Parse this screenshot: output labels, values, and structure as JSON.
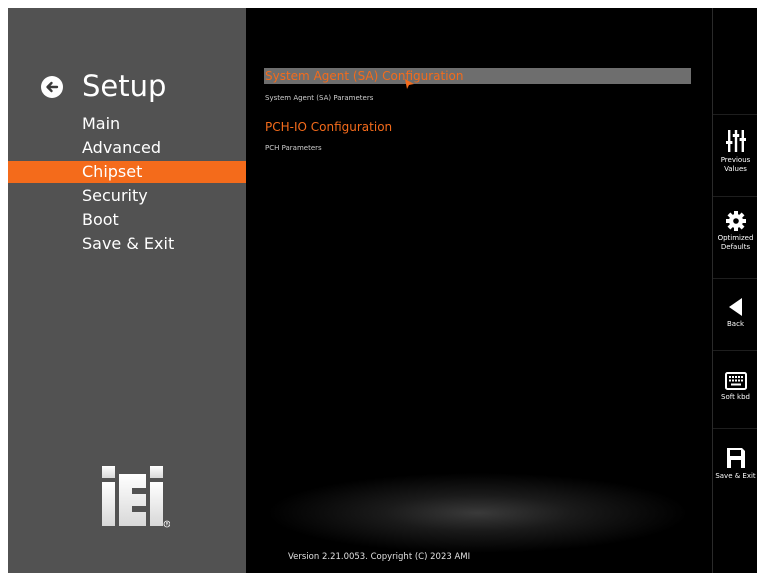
{
  "sidebar": {
    "title": "Setup",
    "menu": [
      {
        "label": "Main",
        "active": false
      },
      {
        "label": "Advanced",
        "active": false
      },
      {
        "label": "Chipset",
        "active": true
      },
      {
        "label": "Security",
        "active": false
      },
      {
        "label": "Boot",
        "active": false
      },
      {
        "label": "Save & Exit",
        "active": false
      }
    ],
    "logo_text": "iEi"
  },
  "main": {
    "items": [
      {
        "title": "System Agent (SA) Configuration",
        "subtitle": "System Agent (SA) Parameters",
        "selected": true
      },
      {
        "title": "PCH-IO Configuration",
        "subtitle": "PCH Parameters",
        "selected": false
      }
    ],
    "footer": "Version 2.21.0053. Copyright (C) 2023 AMI"
  },
  "actions": [
    {
      "label": "Previous Values",
      "icon": "sliders-icon"
    },
    {
      "label": "Optimized Defaults",
      "icon": "gear-icon"
    },
    {
      "label": "Back",
      "icon": "back-triangle-icon"
    },
    {
      "label": "Soft kbd",
      "icon": "keyboard-icon"
    },
    {
      "label": "Save & Exit",
      "icon": "floppy-icon"
    }
  ],
  "colors": {
    "accent": "#f46b1b",
    "sidebar_bg": "#525252",
    "selection_bg": "#6e6e6e",
    "main_bg": "#000000"
  }
}
